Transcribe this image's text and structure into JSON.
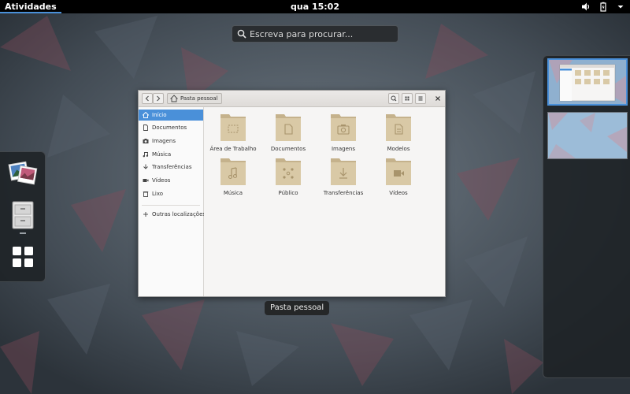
{
  "topbar": {
    "activities": "Atividades",
    "clock": "qua 15:02",
    "tray_icons": [
      "volume-icon",
      "battery-icon",
      "chevron-down-icon"
    ]
  },
  "search": {
    "placeholder": "Escreva para procurar..."
  },
  "dash": {
    "items": [
      {
        "icon": "image-viewer-icon"
      },
      {
        "icon": "file-manager-icon"
      },
      {
        "icon": "show-apps-icon"
      }
    ]
  },
  "window": {
    "path_label": "Pasta pessoal",
    "caption": "Pasta pessoal",
    "sidebar": [
      {
        "label": "Início",
        "icon": "home-icon",
        "active": true
      },
      {
        "label": "Documentos",
        "icon": "document-icon",
        "active": false
      },
      {
        "label": "Imagens",
        "icon": "camera-icon",
        "active": false
      },
      {
        "label": "Música",
        "icon": "music-icon",
        "active": false
      },
      {
        "label": "Transferências",
        "icon": "download-icon",
        "active": false
      },
      {
        "label": "Vídeos",
        "icon": "video-icon",
        "active": false
      },
      {
        "label": "Lixo",
        "icon": "trash-icon",
        "active": false
      },
      {
        "label": "Outras localizações",
        "icon": "plus-icon",
        "active": false
      }
    ],
    "folders": [
      {
        "label": "Área de Trabalho",
        "emblem": "desktop"
      },
      {
        "label": "Documentos",
        "emblem": "document"
      },
      {
        "label": "Imagens",
        "emblem": "camera"
      },
      {
        "label": "Modelos",
        "emblem": "template"
      },
      {
        "label": "Música",
        "emblem": "music"
      },
      {
        "label": "Público",
        "emblem": "share"
      },
      {
        "label": "Transferências",
        "emblem": "download"
      },
      {
        "label": "Vídeos",
        "emblem": "video"
      }
    ]
  },
  "colors": {
    "accent": "#4a90d9",
    "folder": "#d9c9a6",
    "folder_dark": "#c5b28c",
    "topbar": "#000000"
  }
}
